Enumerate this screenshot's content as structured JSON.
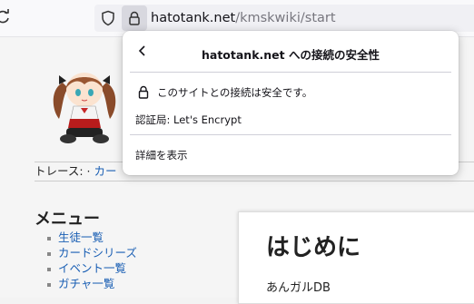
{
  "browser": {
    "url_host": "hatotank.net",
    "url_path": "/kmskwiki/start"
  },
  "popup": {
    "title": "hatotank.net への接続の安全性",
    "secure_message": "このサイトとの接続は安全です。",
    "issuer": "認証局: Let's Encrypt",
    "more_info": "詳細を表示"
  },
  "page": {
    "trace_label": "トレース: ·",
    "trace_link": "カー",
    "menu_title": "メニュー",
    "menu_items": [
      "生徒一覧",
      "カードシリーズ",
      "イベント一覧",
      "ガチャ一覧"
    ],
    "content_title": "はじめに",
    "content_intro": "あんガルDB"
  },
  "colors": {
    "link": "#1a5fb4",
    "urlbar": "#f0f0f4",
    "popup_bg": "#ffffff"
  }
}
